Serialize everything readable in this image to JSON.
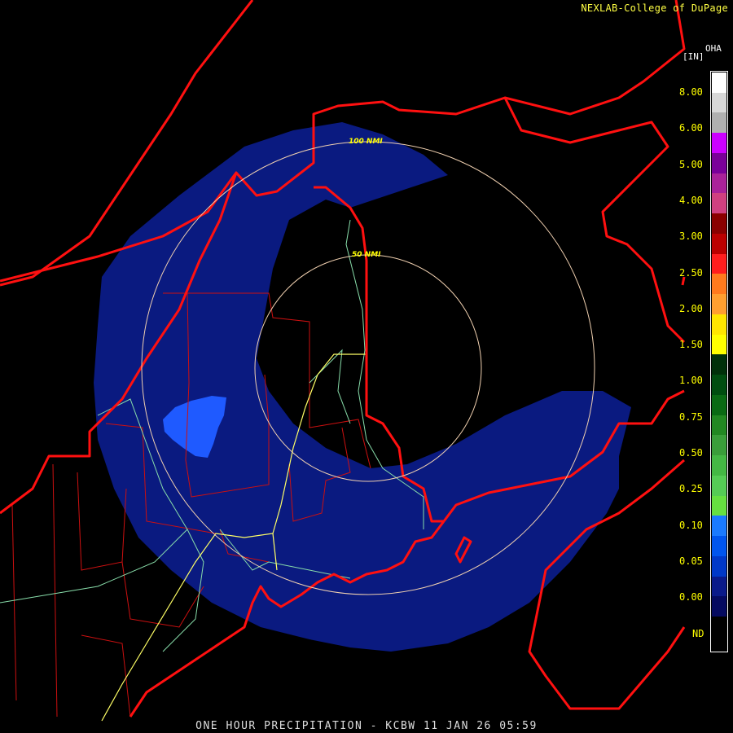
{
  "credit": "NEXLAB-College of DuPage",
  "footer": "ONE HOUR PRECIPITATION - KCBW 11 JAN 26 05:59",
  "legend": {
    "product": "OHA",
    "unit": "[IN]",
    "labels": [
      "8.00",
      "6.00",
      "5.00",
      "4.00",
      "3.00",
      "2.50",
      "2.00",
      "1.50",
      "1.00",
      "0.75",
      "0.50",
      "0.25",
      "0.10",
      "0.05",
      "0.00",
      "ND"
    ],
    "colors": [
      "#ffffff",
      "#d8d8d8",
      "#b0b0b0",
      "#cc00ff",
      "#7a0099",
      "#aa2299",
      "#d04080",
      "#8a0000",
      "#bb0000",
      "#ff1e1e",
      "#ff7a1e",
      "#ff9f30",
      "#ffe600",
      "#ffff00",
      "#00300a",
      "#004d10",
      "#0a6a14",
      "#228822",
      "#3a9e3a",
      "#44b844",
      "#55cc55",
      "#66e040",
      "#1a7aff",
      "#0055ee",
      "#0038c8",
      "#0a1a8a",
      "#050a60"
    ]
  },
  "range_rings": [
    {
      "label": "100 NMI"
    },
    {
      "label": "50 NMI"
    }
  ],
  "colors": {
    "borders": "#ff1010",
    "counties": "#cc1010",
    "highways": "#ffff66",
    "roads": "#88ddaa",
    "precip_light": "#0a1a80",
    "precip_medium": "#1f5aff",
    "rings": "#f0d0b0"
  }
}
